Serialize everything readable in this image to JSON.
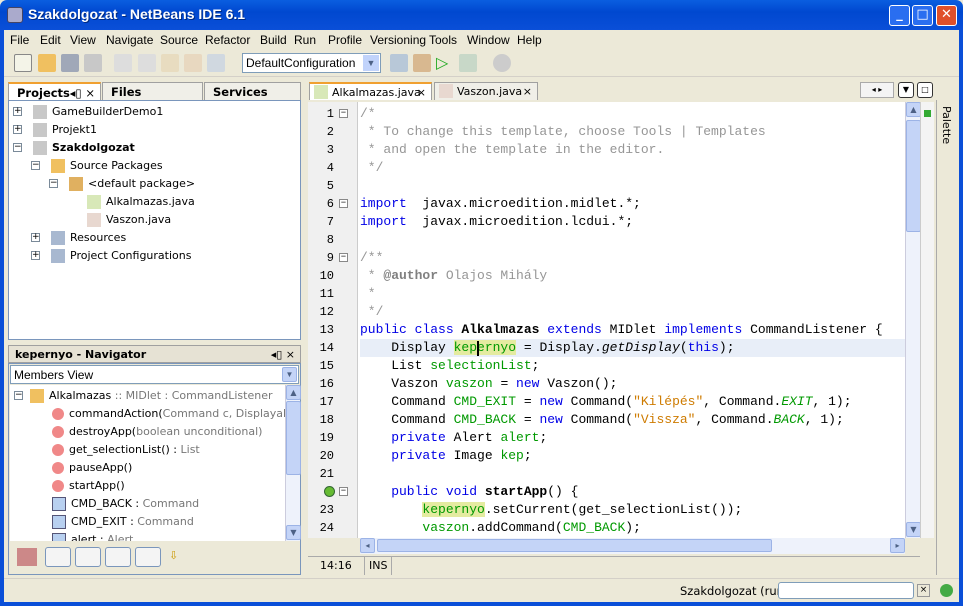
{
  "window": {
    "title": "Szakdolgozat - NetBeans IDE 6.1"
  },
  "menu": [
    "File",
    "Edit",
    "View",
    "Navigate",
    "Source",
    "Refactor",
    "Build",
    "Run",
    "Profile",
    "Versioning",
    "Tools",
    "Window",
    "Help"
  ],
  "toolbar": {
    "configuration": "DefaultConfiguration"
  },
  "left_tabs": {
    "projects": "Projects",
    "files": "Files",
    "services": "Services"
  },
  "projects": [
    {
      "label": "GameBuilderDemo1",
      "level": 0,
      "expander": "+"
    },
    {
      "label": "Projekt1",
      "level": 0,
      "expander": "+"
    },
    {
      "label": "Szakdolgozat",
      "level": 0,
      "expander": "-",
      "bold": true
    },
    {
      "label": "Source Packages",
      "level": 1,
      "expander": "-"
    },
    {
      "label": "<default package>",
      "level": 2,
      "expander": "-"
    },
    {
      "label": "Alkalmazas.java",
      "level": 3,
      "expander": ""
    },
    {
      "label": "Vaszon.java",
      "level": 3,
      "expander": ""
    },
    {
      "label": "Resources",
      "level": 1,
      "expander": "+"
    },
    {
      "label": "Project Configurations",
      "level": 1,
      "expander": "+"
    }
  ],
  "navigator": {
    "title": "kepernyo - Navigator",
    "view": "Members View",
    "root": {
      "name": "Alkalmazas",
      "detail": " :: MIDlet : CommandListener"
    },
    "items": [
      {
        "name": "commandAction(",
        "detail": "Command c, Displayable d)",
        "kind": "method"
      },
      {
        "name": "destroyApp(",
        "detail": "boolean unconditional)",
        "kind": "method"
      },
      {
        "name": "get_selectionList() : ",
        "detail": "List",
        "kind": "method"
      },
      {
        "name": "pauseApp()",
        "detail": "",
        "kind": "method"
      },
      {
        "name": "startApp()",
        "detail": "",
        "kind": "method"
      },
      {
        "name": "CMD_BACK : ",
        "detail": "Command",
        "kind": "field"
      },
      {
        "name": "CMD_EXIT : ",
        "detail": "Command",
        "kind": "field"
      },
      {
        "name": "alert : ",
        "detail": "Alert",
        "kind": "private-field"
      }
    ]
  },
  "editor_tabs": [
    {
      "label": "Alkalmazas.java",
      "active": true
    },
    {
      "label": "Vaszon.java",
      "active": false
    }
  ],
  "code": [
    [
      [
        "cm",
        "/*"
      ]
    ],
    [
      [
        "cm",
        " * To change this template, choose Tools | Templates"
      ]
    ],
    [
      [
        "cm",
        " * and open the template in the editor."
      ]
    ],
    [
      [
        "cm",
        " */"
      ]
    ],
    [],
    [
      [
        "kw",
        "import"
      ],
      [
        "",
        "  javax.microedition.midlet.*;"
      ]
    ],
    [
      [
        "kw",
        "import"
      ],
      [
        "",
        "  javax.microedition.lcdui.*;"
      ]
    ],
    [],
    [
      [
        "cm",
        "/**"
      ]
    ],
    [
      [
        "cm",
        " * "
      ],
      [
        "ck",
        "@author"
      ],
      [
        "cm",
        " Olajos Mihály"
      ]
    ],
    [
      [
        "cm",
        " *"
      ]
    ],
    [
      [
        "cm",
        " */"
      ]
    ],
    [
      [
        "kw",
        "public class "
      ],
      [
        "b",
        "Alkalmazas"
      ],
      [
        "kw",
        " extends "
      ],
      [
        "",
        "MIDlet "
      ],
      [
        "kw",
        "implements "
      ],
      [
        "",
        "CommandListener {"
      ]
    ],
    [
      [
        "",
        "    Display "
      ],
      [
        "fld hl",
        "kepernyo"
      ],
      [
        "",
        " = Display."
      ],
      [
        "it",
        "getDisplay"
      ],
      [
        "",
        "("
      ],
      [
        "kw",
        "this"
      ],
      [
        "",
        ");"
      ]
    ],
    [
      [
        "",
        "    List "
      ],
      [
        "fld",
        "selectionList"
      ],
      [
        "",
        ";"
      ]
    ],
    [
      [
        "",
        "    Vaszon "
      ],
      [
        "fld",
        "vaszon"
      ],
      [
        "",
        " = "
      ],
      [
        "kw",
        "new"
      ],
      [
        "",
        " Vaszon();"
      ]
    ],
    [
      [
        "",
        "    Command "
      ],
      [
        "fld",
        "CMD_EXIT"
      ],
      [
        "",
        " = "
      ],
      [
        "kw",
        "new"
      ],
      [
        "",
        " Command("
      ],
      [
        "str",
        "\"Kilépés\""
      ],
      [
        "",
        ", Command."
      ],
      [
        "fi",
        "EXIT"
      ],
      [
        "",
        ", 1);"
      ]
    ],
    [
      [
        "",
        "    Command "
      ],
      [
        "fld",
        "CMD_BACK"
      ],
      [
        "",
        " = "
      ],
      [
        "kw",
        "new"
      ],
      [
        "",
        " Command("
      ],
      [
        "str",
        "\"Vissza\""
      ],
      [
        "",
        ", Command."
      ],
      [
        "fi",
        "BACK"
      ],
      [
        "",
        ", 1);"
      ]
    ],
    [
      [
        "kw",
        "    private"
      ],
      [
        "",
        " Alert "
      ],
      [
        "fld",
        "alert"
      ],
      [
        "",
        ";"
      ]
    ],
    [
      [
        "kw",
        "    private"
      ],
      [
        "",
        " Image "
      ],
      [
        "fld",
        "kep"
      ],
      [
        "",
        ";"
      ]
    ],
    [],
    [
      [
        "kw",
        "    public void "
      ],
      [
        "b",
        "startApp"
      ],
      [
        "",
        "() {"
      ]
    ],
    [
      [
        "",
        "        "
      ],
      [
        "fld hl",
        "kepernyo"
      ],
      [
        "",
        ".setCurrent(get_selectionList());"
      ]
    ],
    [
      [
        "",
        "        "
      ],
      [
        "fld",
        "vaszon"
      ],
      [
        "",
        ".addCommand("
      ],
      [
        "fld",
        "CMD_BACK"
      ],
      [
        "",
        ");"
      ]
    ]
  ],
  "line_numbers": [
    "1",
    "2",
    "3",
    "4",
    "5",
    "6",
    "7",
    "8",
    "9",
    "10",
    "11",
    "12",
    "13",
    "14",
    "15",
    "16",
    "17",
    "18",
    "19",
    "20",
    "21",
    "",
    "23",
    "24"
  ],
  "editor_status": {
    "position": "14:16",
    "mode": "INS"
  },
  "palette": "Palette",
  "status": {
    "task": "Szakdolgozat (run)"
  }
}
